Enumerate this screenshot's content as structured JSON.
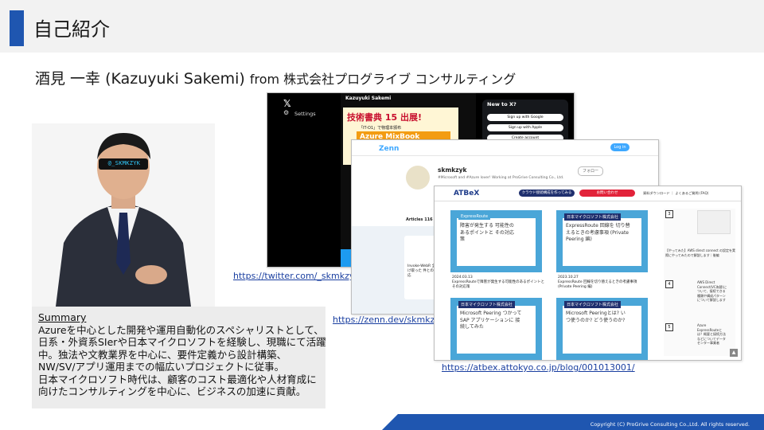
{
  "slide": {
    "title": "自己紹介",
    "name_line": "酒見 一幸 (Kazuyuki Sakemi)",
    "from_line": "from 株式会社プログライブ コンサルティング",
    "accent_color": "#1f56b0"
  },
  "summary": {
    "heading": "Summary",
    "lines": [
      "Azureを中心とした開発や運用自動化のスペシャリストとして、",
      "日系・外資系SIerや日本マイクロソフトを経験し、現職にて活躍",
      "中。独法や文教業界を中心に、要件定義から設計構築、",
      "NW/SV/アプリ運用までの幅広いプロジェクトに従事。",
      "日本マイクロソフト時代は、顧客のコスト最適化や人材育成に",
      "向けたコンサルティングを中心に、ビジネスの加速に貢献。"
    ]
  },
  "photo": {
    "glasses_text": "@_SKMKZYK"
  },
  "links": {
    "twitter": "https://twitter.com/_skmkzyk",
    "zenn": "https://zenn.dev/skmkzyk",
    "atbex": "https://atbex.attokyo.co.jp/blog/001013001/"
  },
  "twitter_screenshot": {
    "settings": "Settings",
    "user": "Kazuyuki Sakemi",
    "banner_title": "技術書典 15 出展!",
    "banner_sub": "「IT-O1」で物理本頒布",
    "banner_book": "Azure MixBook",
    "panel_title": "New to X?",
    "btn_google": "Sign up with Google",
    "btn_apple": "Sign up with Apple",
    "btn_create": "Create account"
  },
  "zenn_screenshot": {
    "logo": "Zenn",
    "login": "Log in",
    "handle": "skmkzyk",
    "bio": "#Microsoft and #Azure lover! Working at ProGrive Consulting Co., Ltd.",
    "follow": "フォロー",
    "tabs": "Articles 116",
    "card_text": "Invoke-WebR 全受け取った 件との対応"
  },
  "atbex_screenshot": {
    "logo": "ATBeX",
    "pill1": "クラウド接続構成を作ってみる",
    "pill2": "お問い合わせ",
    "nav": "資料ダウンロード ｜ よくあるご質問 (FAQ)",
    "card1_tag": "ExpressRoute",
    "card1_title": "障害が発生する 可能性のあるポイントと その対応策",
    "card1_cap": "ExpressRouteで障害が発生する可能性のあるポイントとその対応策",
    "card1_date": "2024.03.13",
    "card2_tag": "日本マイクロソフト株式会社",
    "card2_title": "ExpressRoute 回線を 切り替えるときの考慮事項 (Private Peering 編)",
    "card2_cap": "ExpressRoute 回線を切り替えるときの考慮事項 (Private Peering 編)",
    "card2_date": "2023.10.27",
    "card3_tag": "日本マイクロソフト株式会社",
    "card3_title": "Microsoft Peering つかって SAP アプリケーションに 接続してみた",
    "card4_tag": "日本マイクロソフト株式会社",
    "card4_title": "Microsoft Peeringとは? いつ使うのか? どう使うのか?",
    "right_1": "【やってみた】AWS direct connect の設定を実際にやってみたので解説します｜後編",
    "right_2": "AWS Direct Connect(VC為替)について、接続できる種類や構成パターンについて解説します",
    "right_3": "Azure ExpressRouteとは？概要と接続方法などについてデータセンター事業者",
    "num3": "3",
    "num4": "4",
    "num5": "5"
  },
  "footer": {
    "copyright": "Copyright (C) ProGrive Consulting Co.,Ltd. All rights reserved.",
    "band_color": "#1f56b0"
  }
}
